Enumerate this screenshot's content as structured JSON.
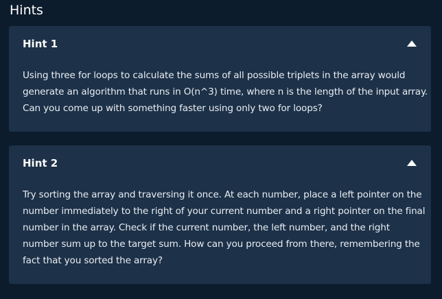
{
  "section_title": "Hints",
  "hints": [
    {
      "title": "Hint 1",
      "expanded": true,
      "toggle_icon": "chevron-up-icon",
      "lines": [
        "Using three for loops to calculate the sums of all possible triplets in the array would",
        "generate an algorithm that runs in O(n^3) time, where n is the length of the input array.",
        "Can you come up with something faster using only two for loops?"
      ]
    },
    {
      "title": "Hint 2",
      "expanded": true,
      "toggle_icon": "chevron-up-icon",
      "lines": [
        "Try sorting the array and traversing it once. At each number, place a left pointer on the",
        "number immediately to the right of your current number and a right pointer on the final",
        "number in the array. Check if the current number, the left number, and the right",
        "number sum up to the target sum. How can you proceed from there, remembering the",
        "fact that you sorted the array?"
      ]
    }
  ],
  "colors": {
    "page_background": "#0d1c2c",
    "card_background": "#1d3148",
    "text": "#ffffff"
  }
}
